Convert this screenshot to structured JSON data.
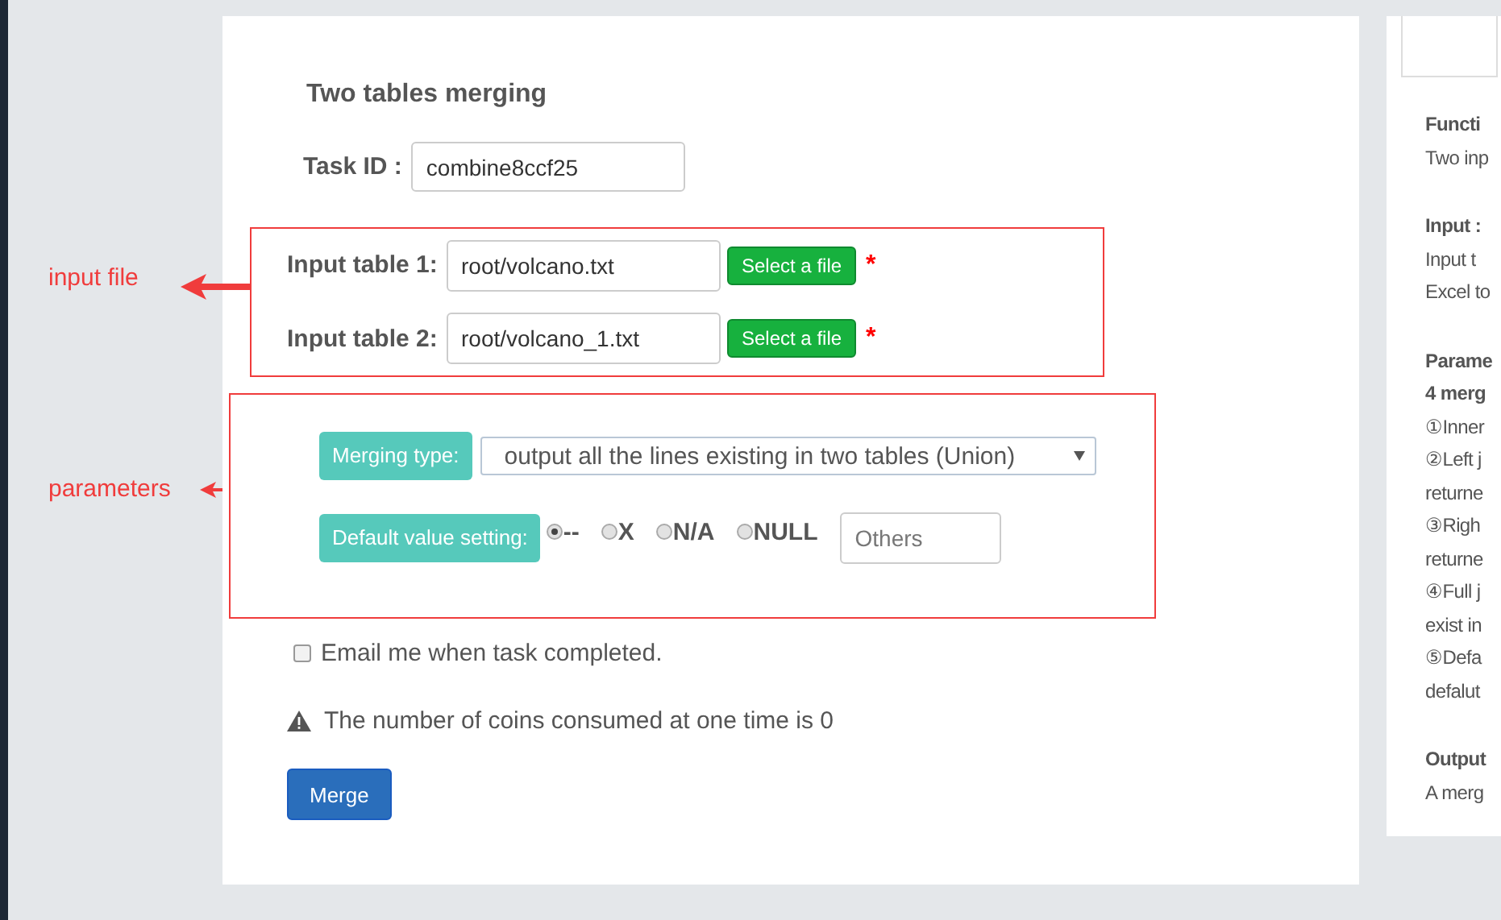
{
  "main": {
    "title": "Two tables merging",
    "task_id": {
      "label": "Task ID :",
      "value": "combine8ccf25"
    },
    "input_files": [
      {
        "label": "Input table 1:",
        "value": "root/volcano.txt",
        "button": "Select a file",
        "required_mark": "*"
      },
      {
        "label": "Input table 2:",
        "value": "root/volcano_1.txt",
        "button": "Select a file",
        "required_mark": "*"
      }
    ],
    "merging_type": {
      "label": "Merging type:",
      "value": "output all the lines existing in two tables (Union)"
    },
    "default_value": {
      "label": "Default value setting:",
      "options": [
        {
          "label": "--",
          "selected": true
        },
        {
          "label": "X",
          "selected": false
        },
        {
          "label": "N/A",
          "selected": false
        },
        {
          "label": "NULL",
          "selected": false
        }
      ],
      "others": {
        "placeholder": "Others"
      }
    },
    "email": {
      "label": "Email me when task completed.",
      "checked": false
    },
    "notice": "The number of coins consumed at one time is 0",
    "merge_button": "Merge"
  },
  "annotations": [
    {
      "text": "input file"
    },
    {
      "text": "parameters"
    }
  ],
  "help_panel": {
    "sections": [
      {
        "lines": [
          {
            "text": "Functi",
            "bold": true
          },
          {
            "text": "Two inp",
            "bold": false
          }
        ]
      },
      {
        "lines": [
          {
            "text": "Input :",
            "bold": true
          },
          {
            "text": "Input t",
            "bold": false
          },
          {
            "text": "Excel to",
            "bold": false
          }
        ]
      },
      {
        "lines": [
          {
            "text": "Parame",
            "bold": true
          },
          {
            "text": "4 merg",
            "bold": true
          },
          {
            "text": "①Inner",
            "bold": false
          },
          {
            "text": "②Left j",
            "bold": false
          },
          {
            "text": "returne",
            "bold": false
          },
          {
            "text": "③Righ",
            "bold": false
          },
          {
            "text": "returne",
            "bold": false
          },
          {
            "text": "④Full j",
            "bold": false
          },
          {
            "text": "exist in",
            "bold": false
          },
          {
            "text": "⑤Defa",
            "bold": false
          },
          {
            "text": "defalut",
            "bold": false
          }
        ]
      },
      {
        "lines": [
          {
            "text": "Output",
            "bold": true
          },
          {
            "text": "A merg",
            "bold": false
          }
        ]
      }
    ]
  }
}
